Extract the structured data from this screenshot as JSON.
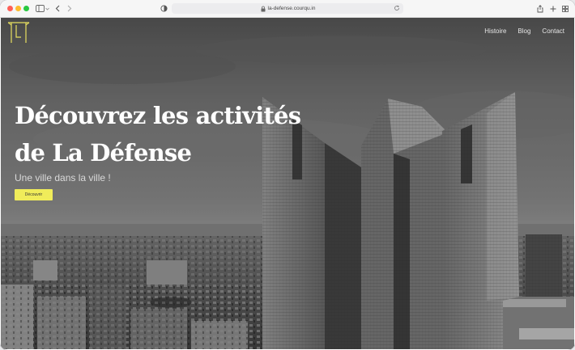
{
  "browser": {
    "url": "la-defense.courqu.in"
  },
  "nav": {
    "items": [
      "Histoire",
      "Blog",
      "Contact"
    ]
  },
  "hero": {
    "title_line1": "Découvrez les activités",
    "title_line2": "de La Défense",
    "subtitle": "Une ville dans la ville !",
    "cta_label": "Découvrir"
  },
  "colors": {
    "accent": "#f0ec5a",
    "logo": "#e8e060"
  }
}
